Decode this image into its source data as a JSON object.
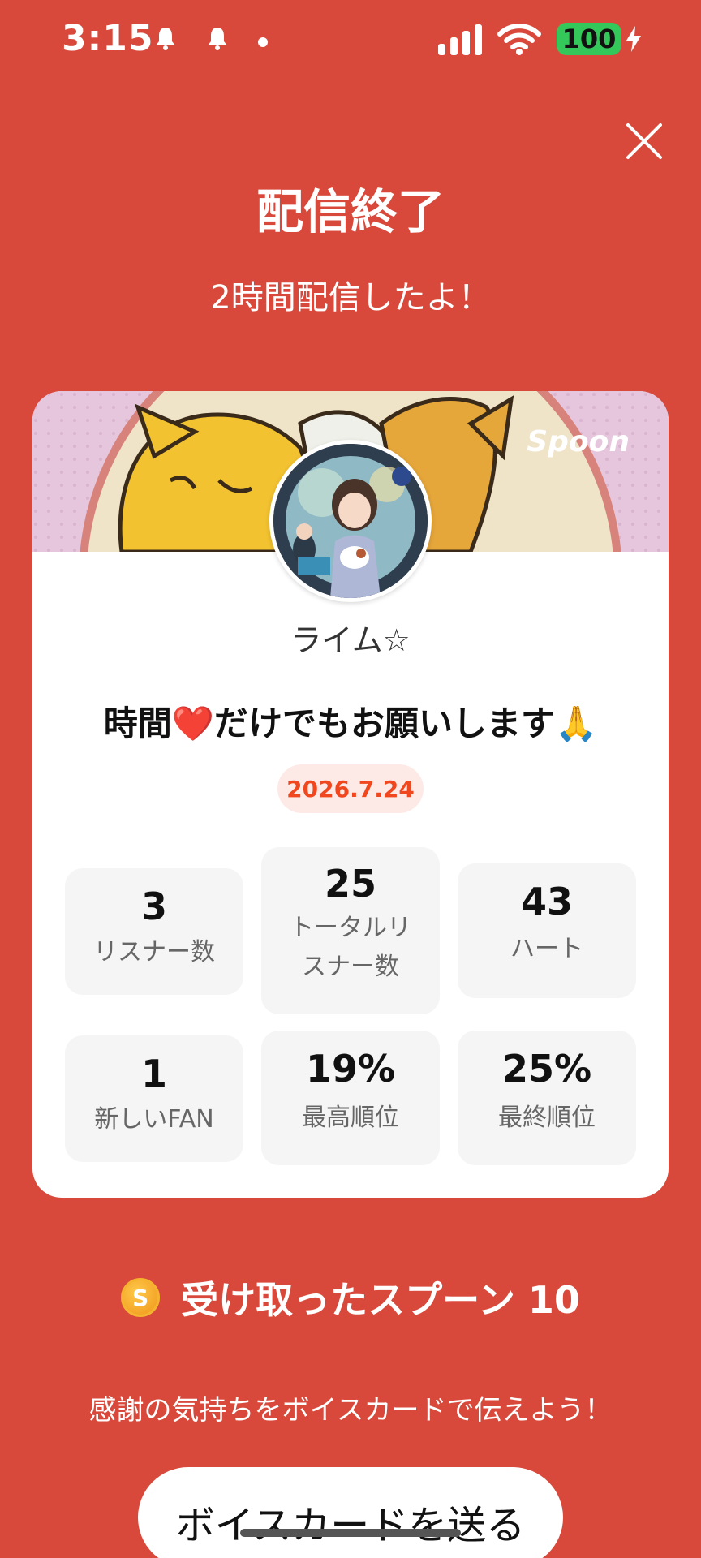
{
  "status_bar": {
    "time": "3:15",
    "battery": "100"
  },
  "header": {
    "title": "配信終了",
    "subtitle": "2時間配信したよ！"
  },
  "card": {
    "logo": "Spoon",
    "username": "ライム☆",
    "broadcast_title": "時間❤️だけでもお願いします🙏",
    "date": "2026.7.24",
    "stats": {
      "listeners": {
        "value": "3",
        "label": "リスナー数"
      },
      "total_listeners": {
        "value": "25",
        "label_line1": "トータルリ",
        "label_line2": "スナー数"
      },
      "hearts": {
        "value": "43",
        "label": "ハート"
      },
      "new_fans": {
        "value": "1",
        "label": "新しいFAN"
      },
      "highest_rank": {
        "value": "19%",
        "label": "最高順位"
      },
      "final_rank": {
        "value": "25%",
        "label": "最終順位"
      }
    }
  },
  "spoons": {
    "coin_letter": "S",
    "text": "受け取ったスプーン 10"
  },
  "footer": {
    "thanks_text": "感謝の気持ちをボイスカードで伝えよう！",
    "button_label": "ボイスカードを送る"
  },
  "colors": {
    "background": "#D8493B",
    "date_text": "#F0471F",
    "battery": "#34C759"
  }
}
